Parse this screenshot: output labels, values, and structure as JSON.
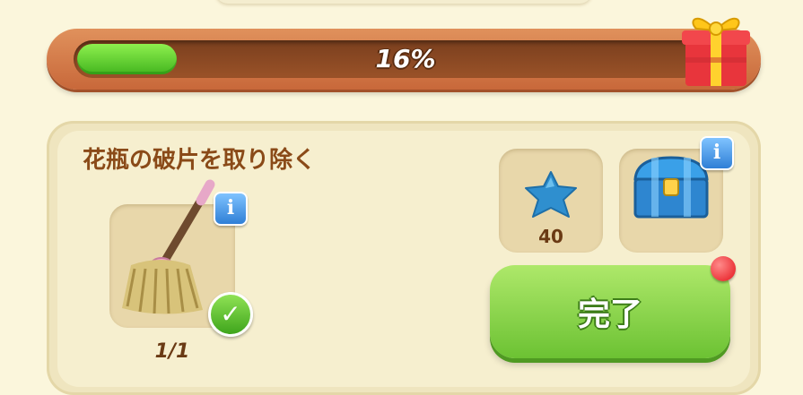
{
  "progress": {
    "percent_text": "16%",
    "fill_fraction": 0.16
  },
  "task": {
    "title": "花瓶の破片を取り除く",
    "item_icon": "mop-icon",
    "count": "1/1",
    "completed": true
  },
  "rewards": [
    {
      "icon": "blue-star-icon",
      "amount": "40"
    },
    {
      "icon": "blue-chest-icon"
    }
  ],
  "actions": {
    "complete_label": "完了"
  },
  "colors": {
    "progress_fill": "#43b51f",
    "button_green": "#6cc233",
    "title_brown": "#8a4a18",
    "notification_red": "#e4141b"
  }
}
